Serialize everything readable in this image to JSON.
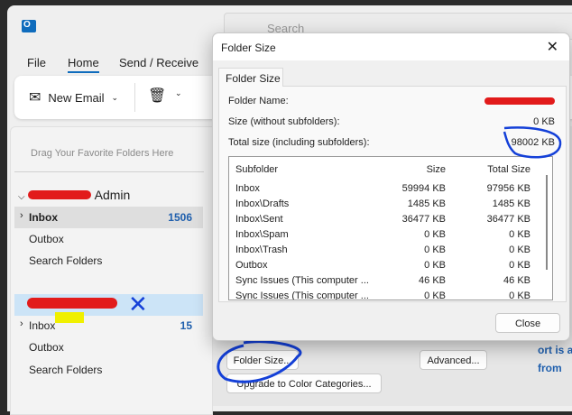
{
  "app": {
    "tabs": [
      "File",
      "Home",
      "Send / Receive"
    ],
    "active_tab": "Home",
    "search_placeholder": "Search",
    "new_email": "New Email",
    "accent": "#0f6cbd"
  },
  "folders": {
    "favorites_hint": "Drag Your Favorite Folders Here",
    "account1": {
      "name_suffix": "Admin",
      "items": [
        {
          "label": "Inbox",
          "count": "1506"
        },
        {
          "label": "Outbox"
        },
        {
          "label": "Search Folders"
        }
      ]
    },
    "account2": {
      "items": [
        {
          "label": "Inbox",
          "count": "15"
        },
        {
          "label": "Outbox"
        },
        {
          "label": "Search Folders"
        }
      ]
    }
  },
  "background": {
    "folder_size_button": "Folder Size...",
    "advanced_button": "Advanced...",
    "upgrade_button": "Upgrade to Color Categories...",
    "side_text1": "ort is av",
    "side_text2": "from"
  },
  "dialog": {
    "title": "Folder Size",
    "tab": "Folder Size",
    "folder_name_label": "Folder Name:",
    "size_label": "Size (without subfolders):",
    "size_value": "0 KB",
    "total_label": "Total size (including subfolders):",
    "total_value": "98002 KB",
    "columns": [
      "Subfolder",
      "Size",
      "Total Size"
    ],
    "rows": [
      [
        "Inbox",
        "59994 KB",
        "97956 KB"
      ],
      [
        "Inbox\\Drafts",
        "1485 KB",
        "1485 KB"
      ],
      [
        "Inbox\\Sent",
        "36477 KB",
        "36477 KB"
      ],
      [
        "Inbox\\Spam",
        "0 KB",
        "0 KB"
      ],
      [
        "Inbox\\Trash",
        "0 KB",
        "0 KB"
      ],
      [
        "Outbox",
        "0 KB",
        "0 KB"
      ],
      [
        "Sync Issues (This computer ...",
        "46 KB",
        "46 KB"
      ],
      [
        "Sync Issues (This computer ...",
        "0 KB",
        "0 KB"
      ]
    ],
    "close_button": "Close"
  }
}
